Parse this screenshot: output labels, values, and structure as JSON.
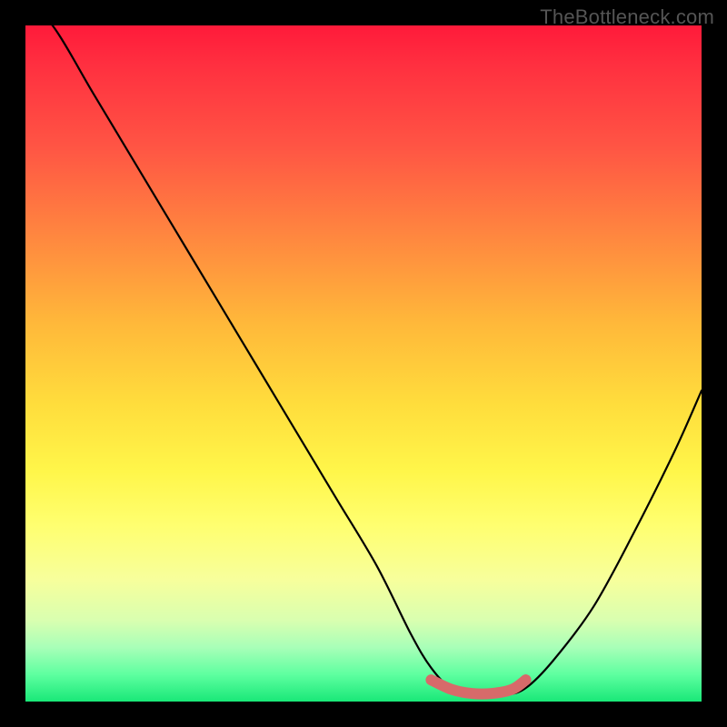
{
  "watermark": "TheBottleneck.com",
  "chart_data": {
    "type": "line",
    "title": "",
    "xlabel": "",
    "ylabel": "",
    "xlim": [
      0,
      100
    ],
    "ylim": [
      0,
      100
    ],
    "series": [
      {
        "name": "bottleneck-curve",
        "x": [
          0,
          4,
          10,
          16,
          22,
          28,
          34,
          40,
          46,
          52,
          57,
          60,
          63,
          67,
          71,
          74,
          78,
          84,
          90,
          96,
          100
        ],
        "y": [
          103,
          100,
          90,
          80,
          70,
          60,
          50,
          40,
          30,
          20,
          10,
          5,
          2,
          1,
          1,
          2,
          6,
          14,
          25,
          37,
          46
        ]
      }
    ],
    "highlight": {
      "name": "optimal-range",
      "x": [
        60,
        63,
        66,
        69,
        72,
        74
      ],
      "y": [
        3.2,
        1.8,
        1.2,
        1.2,
        1.8,
        3.2
      ]
    },
    "gradient_stops": [
      {
        "pos": 0,
        "color": "#ff1a3a"
      },
      {
        "pos": 18,
        "color": "#ff5544"
      },
      {
        "pos": 44,
        "color": "#ffb83a"
      },
      {
        "pos": 66,
        "color": "#fff64a"
      },
      {
        "pos": 88,
        "color": "#d9ffb0"
      },
      {
        "pos": 100,
        "color": "#19e878"
      }
    ]
  }
}
